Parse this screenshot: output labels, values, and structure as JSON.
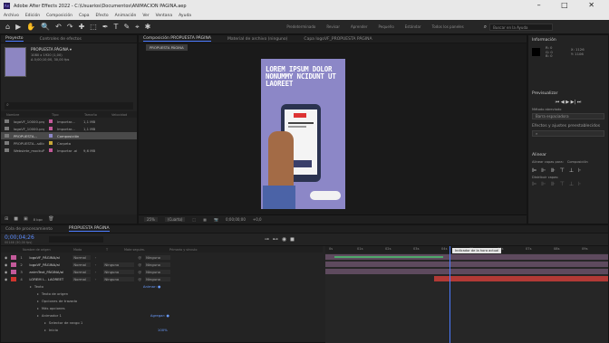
{
  "titlebar": {
    "logo": "Ae",
    "title": "Adobe After Effects 2022 - C:\\Usuarios\\Documentos\\ANIMACION PAGINA.aep",
    "controls": "– □ ✕"
  },
  "menu": [
    "Archivo",
    "Edición",
    "Composición",
    "Capa",
    "Efecto",
    "Animación",
    "Ver",
    "Ventana",
    "Ayuda"
  ],
  "toolbar": {
    "tools": [
      "⌂",
      "▶",
      "✋",
      "🔍",
      "↶",
      "↷",
      "✚",
      "⬚",
      "✒",
      "T",
      "✎",
      "⌖",
      "✱"
    ],
    "workspaces": [
      "Predeterminado",
      "Revisar",
      "Aprender",
      "Pequeño",
      "Estándar",
      "Todos los paneles"
    ],
    "search_placeholder": "Buscar en la Ayuda"
  },
  "project": {
    "tab_project": "Proyecto",
    "tab_effects": "Controles de efectos",
    "item_name": "PROPUESTA PÁGINA ▾",
    "item_info1": "1080 x 1920 (1,00)",
    "item_info2": "Δ 0;00;10;00, 30,00 fps",
    "search": "⌕",
    "columns": [
      "Nombre",
      "Tipo",
      "Tamaño",
      "Velocidad"
    ],
    "rows": [
      {
        "name": "logoVF_10000.png",
        "type": "Importar...",
        "size": "1,1 MB",
        "color": "#c45a9a",
        "sel": false
      },
      {
        "name": "logoVF_10000.png",
        "type": "Importar...",
        "size": "1,1 MB",
        "color": "#c45a9a",
        "sel": false
      },
      {
        "name": "PROPUESTA...",
        "type": "Composición",
        "size": "",
        "color": "#8c87c7",
        "sel": true
      },
      {
        "name": "PROPUESTA...sólid",
        "type": "Carpeta",
        "size": "",
        "color": "#c8a838",
        "sel": false
      },
      {
        "name": "Websiete_mockuP",
        "type": "Importar .ai",
        "size": "9,6 MB",
        "color": "#c45a9a",
        "sel": false
      }
    ],
    "footer_label": "8 bpc"
  },
  "composition": {
    "tab": "Composición PROPUESTA PÁGINA",
    "tab2": "Material de archivo (ninguno)",
    "tab3": "Capa logoVF_PROPUESTA PÁGINA",
    "breadcrumb": "PROPUESTA PÁGINA",
    "headline": "LOREM IPSUM DOLOR NONUMMY NCIDUNT UT LAOREET",
    "footer_zoom": "25%",
    "footer_res": "(Cuarto)",
    "footer_time": "0;00;00;00",
    "footer_extra": "+0,0"
  },
  "right": {
    "info_title": "Información",
    "info_r": "R: 0",
    "info_g": "G: 0",
    "info_b": "B: 0",
    "info_x": "X: 1126",
    "info_y": "Y: 1106",
    "preview_title": "Previsualizar",
    "preview_controls": "⏮ ◀ ▶ ▶| ⏭",
    "method_label": "Método abreviado",
    "method_value": "Barra espaciadora",
    "effects_title": "Efectos y ajustes preestablecidos",
    "align_title": "Alinear",
    "align_label": "Alinear capas para:",
    "align_value": "Composición",
    "distribute_label": "Distribuir capas:"
  },
  "timeline": {
    "tab_render": "Cola de procesamiento",
    "tab_comp": "PROPUESTA PÁGINA",
    "timecode": "0;00;04;26",
    "fps": "00146 (30,00 fps)",
    "col_headers": [
      "Nombre de origen",
      "Modo",
      "T",
      "Mate seguim.",
      "Primario y vínculo"
    ],
    "layers": [
      {
        "num": "1",
        "name": "logoVF_PÁGINA/al",
        "mode": "Normal",
        "matte": "",
        "parent": "Ninguno",
        "color": "#c45a9a"
      },
      {
        "num": "2",
        "name": "logoVF_PÁGINA/al",
        "mode": "Normal",
        "matte": "Ninguno",
        "parent": "Ninguno",
        "color": "#c45a9a"
      },
      {
        "num": "3",
        "name": "animText_PÁGINA/al",
        "mode": "Normal",
        "matte": "Ninguno",
        "parent": "Ninguno",
        "color": "#c45a9a"
      },
      {
        "num": "4",
        "name": "LOREM I... LAOREET",
        "mode": "Normal",
        "matte": "Ninguno",
        "parent": "Ninguno",
        "color": "#d0352d"
      }
    ],
    "props": [
      {
        "label": "Texto",
        "extra": "Animar: ●"
      },
      {
        "label": "Texto de origen",
        "extra": ""
      },
      {
        "label": "Opciones de trazado",
        "extra": ""
      },
      {
        "label": "Más opciones",
        "extra": ""
      },
      {
        "label": "Animador 1",
        "extra": "Agregar: ●"
      },
      {
        "label": "Selector de rango 1",
        "extra": ""
      },
      {
        "label": "Inicio",
        "extra": "100%"
      }
    ],
    "ruler": [
      "0s",
      "01s",
      "02s",
      "03s",
      "04s",
      "05s",
      "06s",
      "07s",
      "08s",
      "09s"
    ],
    "tooltip": "Indicador de la hora actual",
    "progress": 0.44
  }
}
